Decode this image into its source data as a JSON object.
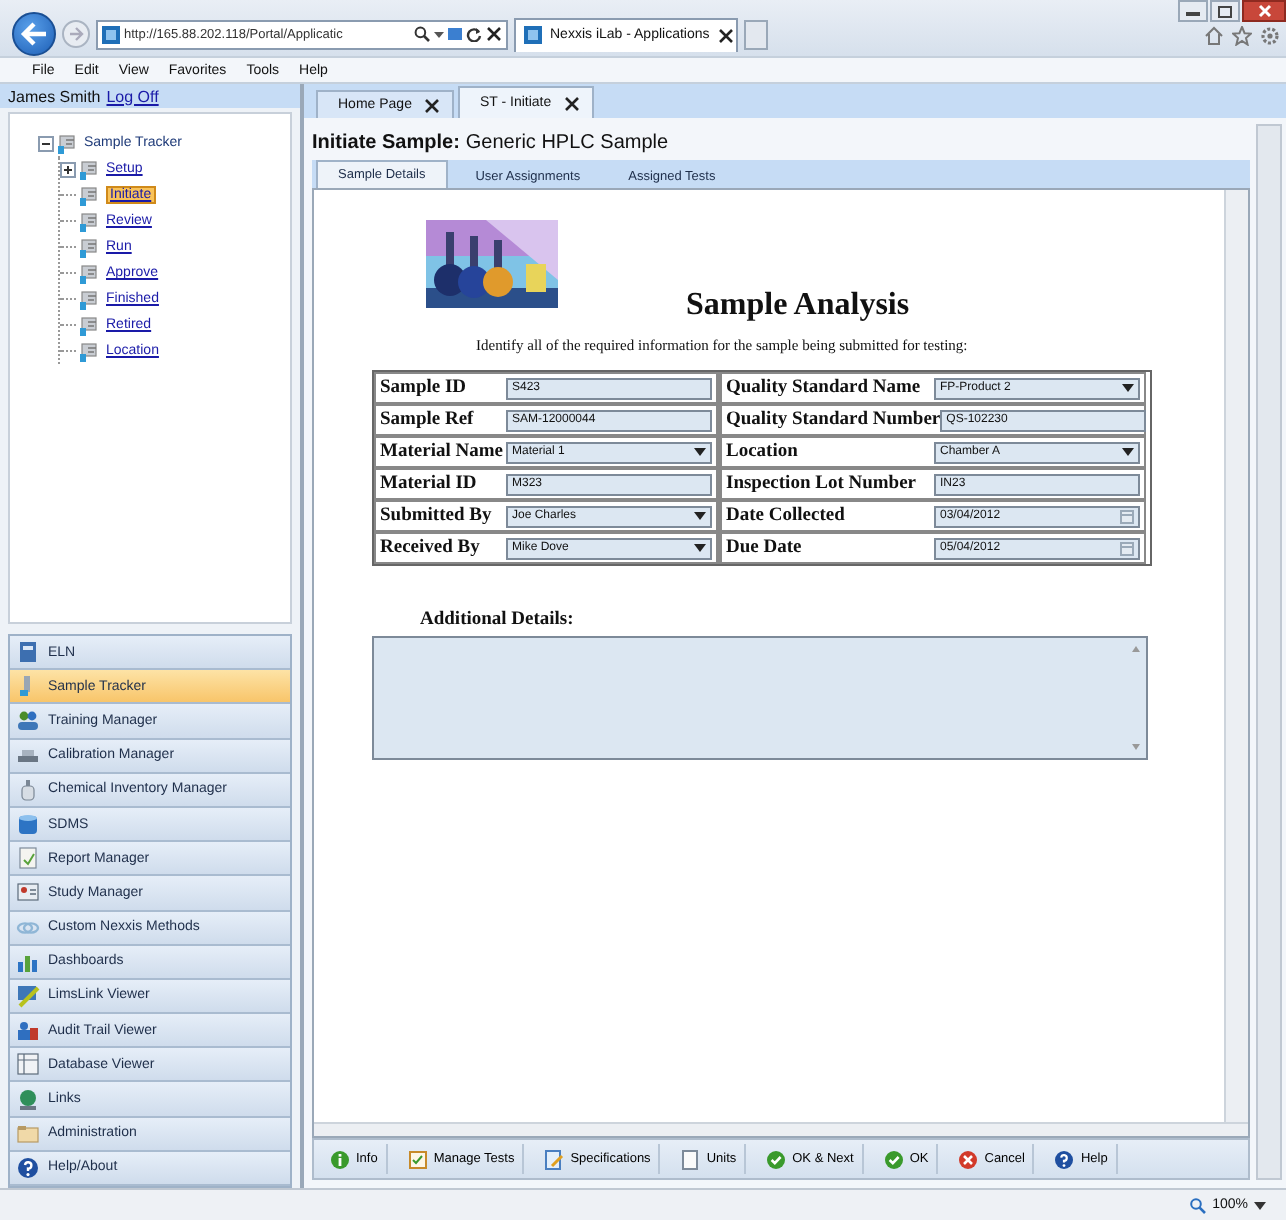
{
  "browser": {
    "address": "http://165.88.202.118/Portal/Applicatic",
    "tab_title": "Nexxis iLab - Applications",
    "menu": [
      "File",
      "Edit",
      "View",
      "Favorites",
      "Tools",
      "Help"
    ]
  },
  "user": {
    "name": "James Smith",
    "link": "Log Off"
  },
  "tree": {
    "label": "Sample Tracker",
    "expanded": true,
    "children": [
      {
        "label": "Setup",
        "expanded": false,
        "selected": false
      },
      {
        "label": "Initiate",
        "selected": true
      },
      {
        "label": "Review",
        "selected": false
      },
      {
        "label": "Run",
        "selected": false
      },
      {
        "label": "Approve",
        "selected": false
      },
      {
        "label": "Finished",
        "selected": false
      },
      {
        "label": "Retired",
        "selected": false
      },
      {
        "label": "Location",
        "selected": false
      }
    ]
  },
  "nav": [
    {
      "label": "ELN",
      "selected": false
    },
    {
      "label": "Sample Tracker",
      "selected": true
    },
    {
      "label": "Training Manager",
      "selected": false
    },
    {
      "label": "Calibration Manager",
      "selected": false
    },
    {
      "label": "Chemical Inventory Manager",
      "selected": false
    },
    {
      "label": "SDMS",
      "selected": false
    },
    {
      "label": "Report Manager",
      "selected": false
    },
    {
      "label": "Study Manager",
      "selected": false
    },
    {
      "label": "Custom Nexxis Methods",
      "selected": false
    },
    {
      "label": "Dashboards",
      "selected": false
    },
    {
      "label": "LimsLink Viewer",
      "selected": false
    },
    {
      "label": "Audit Trail Viewer",
      "selected": false
    },
    {
      "label": "Database Viewer",
      "selected": false
    },
    {
      "label": "Links",
      "selected": false
    },
    {
      "label": "Administration",
      "selected": false
    },
    {
      "label": "Help/About",
      "selected": false
    }
  ],
  "doc_tabs": [
    {
      "label": "Home Page",
      "selected": false
    },
    {
      "label": "ST - Initiate",
      "selected": true
    }
  ],
  "page_title": "**Initiate Sample:** Generic HPLC Sample",
  "sub_tabs": [
    {
      "label": "Sample Details",
      "selected": true
    },
    {
      "label": "User Assignments",
      "selected": false
    },
    {
      "label": "Assigned Tests",
      "selected": false
    }
  ],
  "form": {
    "heading": "Sample Analysis",
    "instruction": "Identify all of the required information for the sample being submitted for testing:",
    "fields": [
      {
        "label": "Sample ID",
        "kind": "text",
        "value": "S423"
      },
      {
        "label": "Quality Standard Name",
        "kind": "select",
        "value": "FP-Product 2"
      },
      {
        "label": "Sample Ref",
        "kind": "text",
        "value": "SAM-12000044"
      },
      {
        "label": "Quality Standard Number",
        "kind": "text",
        "value": "QS-102230"
      },
      {
        "label": "Material Name",
        "kind": "select",
        "value": "Material 1"
      },
      {
        "label": "Location",
        "kind": "select",
        "value": "Chamber A"
      },
      {
        "label": "Material ID",
        "kind": "text",
        "value": "M323"
      },
      {
        "label": "Inspection Lot Number",
        "kind": "text",
        "value": "IN23"
      },
      {
        "label": "Submitted By",
        "kind": "select",
        "value": "Joe Charles"
      },
      {
        "label": "Date Collected",
        "kind": "date",
        "value": "03/04/2012"
      },
      {
        "label": "Received By",
        "kind": "select",
        "value": "Mike Dove"
      },
      {
        "label": "Due Date",
        "kind": "date",
        "value": "05/04/2012"
      }
    ],
    "details_label": "Additional Details:"
  },
  "toolbar": [
    {
      "label": "Info",
      "kind": "info"
    },
    {
      "label": "Manage Tests",
      "kind": "tests"
    },
    {
      "label": "Specifications",
      "kind": "specs"
    },
    {
      "label": "Units",
      "kind": "units"
    },
    {
      "label": "OK & Next",
      "kind": "ok"
    },
    {
      "label": "OK",
      "kind": "ok"
    },
    {
      "label": "Cancel",
      "kind": "cancel"
    },
    {
      "label": "Help",
      "kind": "help"
    }
  ],
  "status": {
    "zoom": "100%"
  }
}
